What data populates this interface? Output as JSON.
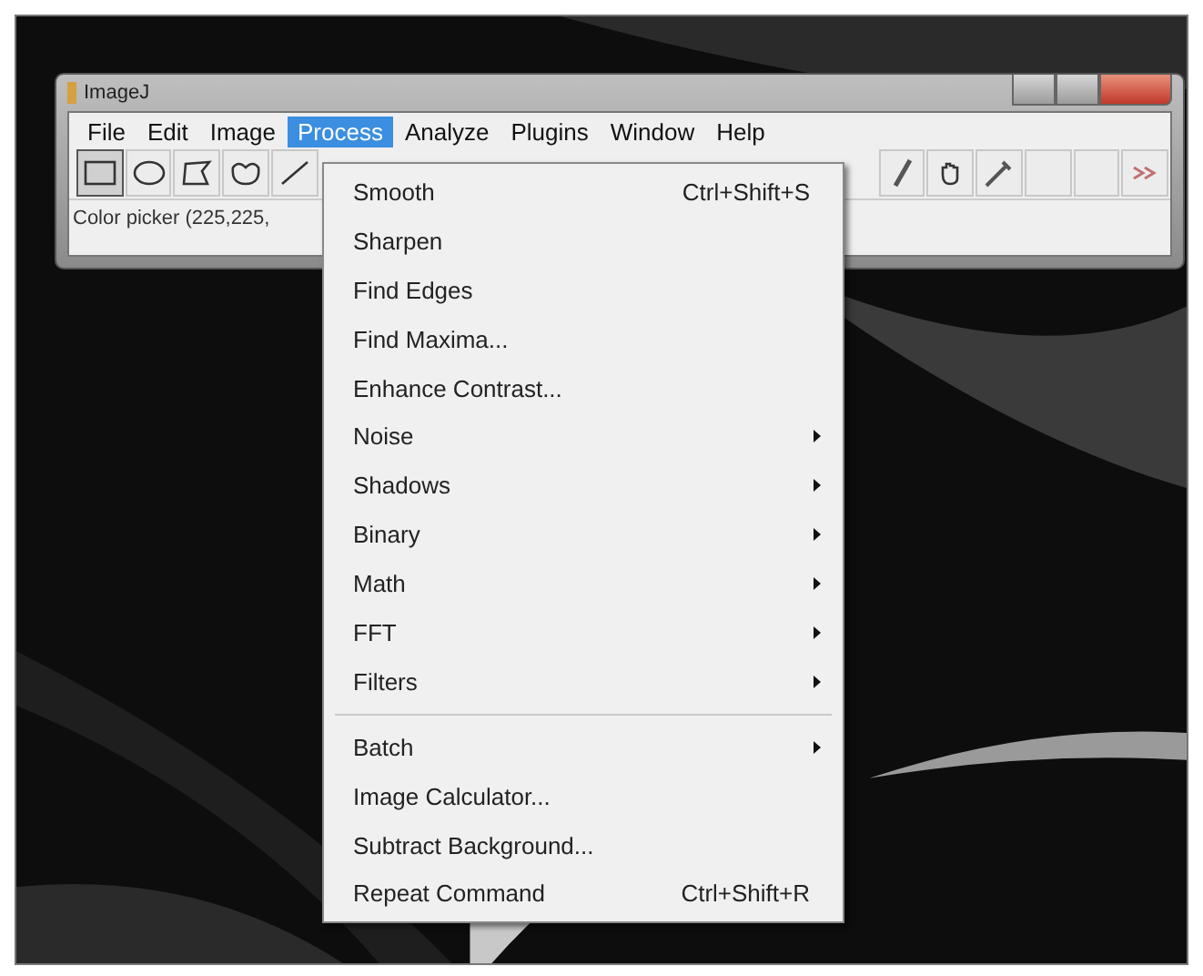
{
  "window": {
    "title": "ImageJ"
  },
  "menubar": [
    {
      "label": "File",
      "selected": false
    },
    {
      "label": "Edit",
      "selected": false
    },
    {
      "label": "Image",
      "selected": false
    },
    {
      "label": "Process",
      "selected": true
    },
    {
      "label": "Analyze",
      "selected": false
    },
    {
      "label": "Plugins",
      "selected": false
    },
    {
      "label": "Window",
      "selected": false
    },
    {
      "label": "Help",
      "selected": false
    }
  ],
  "toolbar_left": [
    {
      "kind": "rectangle",
      "selected": true
    },
    {
      "kind": "oval",
      "selected": false
    },
    {
      "kind": "polygon",
      "selected": false
    },
    {
      "kind": "freehand",
      "selected": false
    },
    {
      "kind": "line",
      "selected": false
    }
  ],
  "toolbar_right": [
    {
      "kind": "brush",
      "selected": false
    },
    {
      "kind": "hand",
      "selected": false
    },
    {
      "kind": "dropper",
      "selected": false
    },
    {
      "kind": "empty",
      "selected": false
    },
    {
      "kind": "empty",
      "selected": false
    },
    {
      "kind": "more",
      "selected": false
    }
  ],
  "status": "Color picker (225,225,",
  "menu": [
    {
      "kind": "item",
      "label": "Smooth",
      "shortcut": "Ctrl+Shift+S",
      "submenu": false
    },
    {
      "kind": "item",
      "label": "Sharpen",
      "submenu": false
    },
    {
      "kind": "item",
      "label": "Find Edges",
      "submenu": false
    },
    {
      "kind": "item",
      "label": "Find Maxima...",
      "submenu": false
    },
    {
      "kind": "item",
      "label": "Enhance Contrast...",
      "submenu": false
    },
    {
      "kind": "item",
      "label": "Noise",
      "submenu": true
    },
    {
      "kind": "item",
      "label": "Shadows",
      "submenu": true
    },
    {
      "kind": "item",
      "label": "Binary",
      "submenu": true
    },
    {
      "kind": "item",
      "label": "Math",
      "submenu": true
    },
    {
      "kind": "item",
      "label": "FFT",
      "submenu": true
    },
    {
      "kind": "item",
      "label": "Filters",
      "submenu": true
    },
    {
      "kind": "separator"
    },
    {
      "kind": "item",
      "label": "Batch",
      "submenu": true
    },
    {
      "kind": "item",
      "label": "Image Calculator...",
      "submenu": false
    },
    {
      "kind": "item",
      "label": "Subtract Background...",
      "submenu": false
    },
    {
      "kind": "item",
      "label": "Repeat Command",
      "shortcut": "Ctrl+Shift+R",
      "submenu": false
    }
  ]
}
